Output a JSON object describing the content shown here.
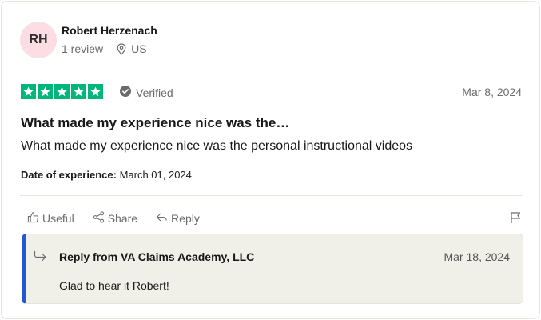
{
  "reviewer": {
    "initials": "RH",
    "name": "Robert Herzenach",
    "review_count": "1 review",
    "location": "US"
  },
  "review": {
    "rating": 5,
    "verified_label": "Verified",
    "date": "Mar 8, 2024",
    "title": "What made my experience nice was the…",
    "body": "What made my experience nice was the personal instructional videos",
    "experience_label": "Date of experience:",
    "experience_date": "March 01, 2024"
  },
  "actions": {
    "useful": "Useful",
    "share": "Share",
    "reply": "Reply"
  },
  "reply": {
    "from": "Reply from VA Claims Academy, LLC",
    "date": "Mar 18, 2024",
    "text": "Glad to hear it Robert!"
  },
  "colors": {
    "star_green": "#00b67a",
    "avatar_bg": "#fcdde3",
    "reply_accent": "#2259d3",
    "reply_bg": "#f1f0e8"
  },
  "icons": [
    "location-pin-icon",
    "star-icon",
    "verified-check-icon",
    "thumbs-up-icon",
    "share-icon",
    "reply-arrow-icon",
    "flag-icon",
    "reply-indent-icon"
  ]
}
